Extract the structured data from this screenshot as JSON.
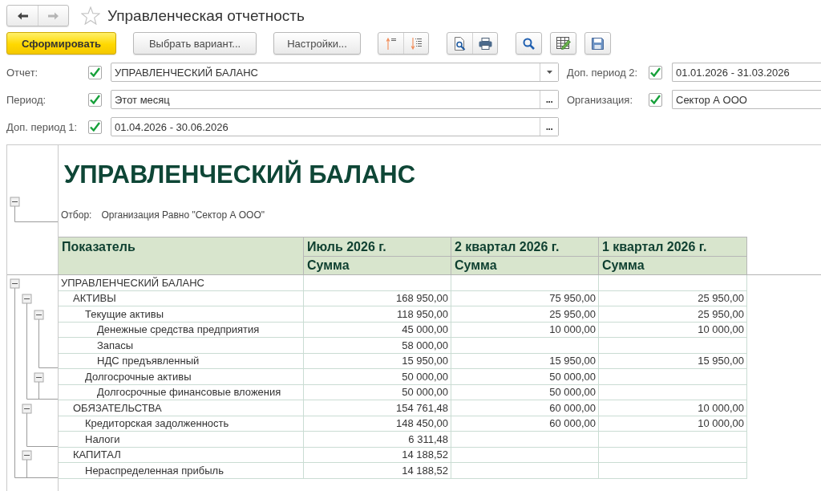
{
  "window": {
    "title": "Управленческая отчетность",
    "favorite": false
  },
  "navigation": [
    {
      "kind": "back",
      "disabled": false
    },
    {
      "kind": "forward",
      "disabled": true
    }
  ],
  "toolbar": {
    "buttons": [
      {
        "label": "Сформировать",
        "kind": "primary"
      },
      {
        "label": "Выбрать вариант...",
        "kind": "default"
      },
      {
        "label": "Настройки...",
        "kind": "default"
      }
    ]
  },
  "parameters": {
    "left": [
      {
        "label": "Отчет:",
        "checked": true,
        "value": "УПРАВЛЕНЧЕСКИЙ БАЛАНС",
        "kind": "dropdown"
      },
      {
        "label": "Период:",
        "checked": true,
        "value": "Этот месяц",
        "kind": "choice",
        "button": "..."
      },
      {
        "label": "Доп. период 1:",
        "checked": true,
        "value": "01.04.2026 - 30.06.2026",
        "kind": "choice",
        "button": "..."
      }
    ],
    "right": [
      {
        "label": "Доп. период 2:",
        "checked": true,
        "value": "01.01.2026 - 31.03.2026"
      },
      {
        "label": "Организация:",
        "checked": true,
        "value": "Сектор А ООО"
      }
    ]
  },
  "report": {
    "title": "УПРАВЛЕНЧЕСКИЙ БАЛАНС",
    "header_expanded": true,
    "filter": {
      "label": "Отбор:",
      "text": "Организация Равно \"Сектор А ООО\""
    },
    "columns": [
      {
        "title": "Показатель"
      },
      {
        "title": "Июль 2026 г.",
        "subtitle": "Сумма"
      },
      {
        "title": "2 квартал 2026 г.",
        "subtitle": "Сумма"
      },
      {
        "title": "1 квартал 2026 г.",
        "subtitle": "Сумма"
      }
    ],
    "rows": [
      {
        "label": "УПРАВЛЕНЧЕСКИЙ БАЛАНС",
        "expanded": true,
        "children": [
          {
            "label": "АКТИВЫ",
            "cells": {
              "column_2": "168 950,00",
              "column_3": "75 950,00",
              "column_4": "25 950,00"
            },
            "expanded": true,
            "children": [
              {
                "label": "Текущие активы",
                "cells": {
                  "column_2": "118 950,00",
                  "column_3": "25 950,00",
                  "column_4": "25 950,00"
                },
                "expanded": true,
                "children": [
                  {
                    "label": "Денежные средства предприятия",
                    "cells": {
                      "column_2": "45 000,00",
                      "column_3": "10 000,00",
                      "column_4": "10 000,00"
                    }
                  },
                  {
                    "label": "Запасы",
                    "cells": {
                      "column_2": "58 000,00"
                    }
                  },
                  {
                    "label": "НДС предъявленный",
                    "cells": {
                      "column_2": "15 950,00",
                      "column_3": "15 950,00",
                      "column_4": "15 950,00"
                    }
                  }
                ]
              },
              {
                "label": "Долгосрочные активы",
                "cells": {
                  "column_2": "50 000,00",
                  "column_3": "50 000,00"
                },
                "expanded": true,
                "children": [
                  {
                    "label": "Долгосрочные финансовые вложения",
                    "cells": {
                      "column_2": "50 000,00",
                      "column_3": "50 000,00"
                    }
                  }
                ]
              }
            ]
          },
          {
            "label": "ОБЯЗАТЕЛЬСТВА",
            "cells": {
              "column_2": "154 761,48",
              "column_3": "60 000,00",
              "column_4": "10 000,00"
            },
            "expanded": true,
            "children": [
              {
                "label": "Кредиторская задолженность",
                "cells": {
                  "column_2": "148 450,00",
                  "column_3": "60 000,00",
                  "column_4": "10 000,00"
                }
              },
              {
                "label": "Налоги",
                "cells": {
                  "column_2": "6 311,48"
                }
              }
            ]
          },
          {
            "label": "КАПИТАЛ",
            "cells": {
              "column_2": "14 188,52"
            },
            "expanded": true,
            "children": [
              {
                "label": "Нераспределенная прибыль",
                "cells": {
                  "column_2": "14 188,52"
                }
              }
            ]
          }
        ]
      }
    ]
  }
}
